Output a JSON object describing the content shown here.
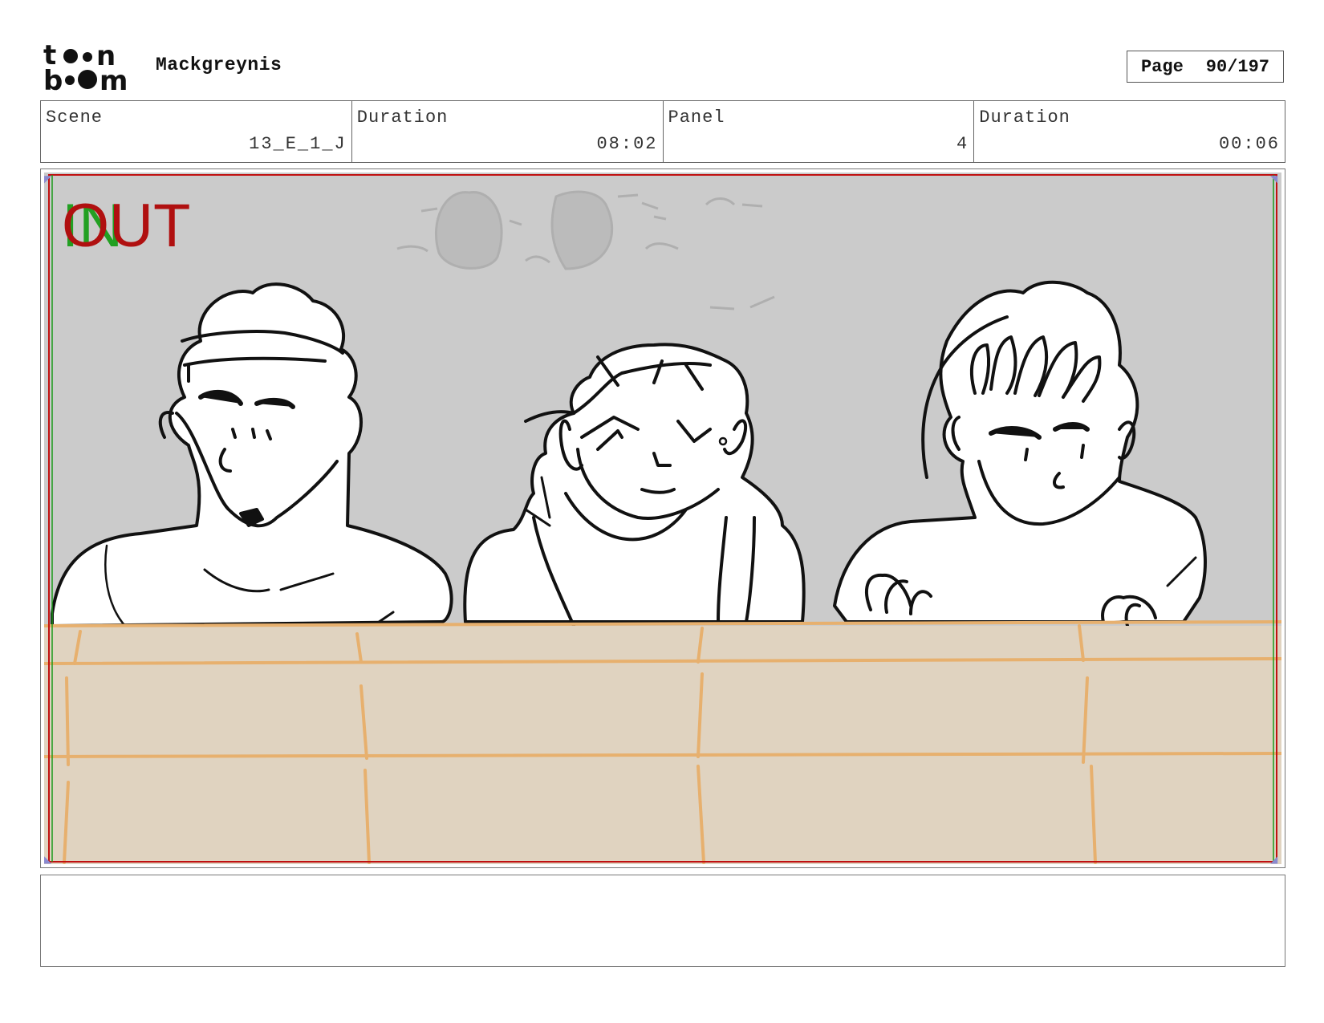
{
  "header": {
    "logo_text_top": "toon",
    "logo_text_bottom": "boom",
    "project_title": "Mackgreynis",
    "page_label": "Page",
    "page_value": "90/197"
  },
  "info": {
    "scene_label": "Scene",
    "scene_value": "13_E_1_J",
    "duration_label": "Duration",
    "duration_value": "08:02",
    "panel_label": "Panel",
    "panel_value": "4",
    "panel_duration_label": "Duration",
    "panel_duration_value": "00:06"
  },
  "panel": {
    "in_marker": "IN",
    "out_marker": "OUT",
    "colors": {
      "sky": "#cbcbcb",
      "wall": "#e0d3c0",
      "brick_line": "#e7b06e",
      "in_green": "#22a022",
      "out_red": "#b01010"
    }
  },
  "notes": {
    "text": ""
  }
}
